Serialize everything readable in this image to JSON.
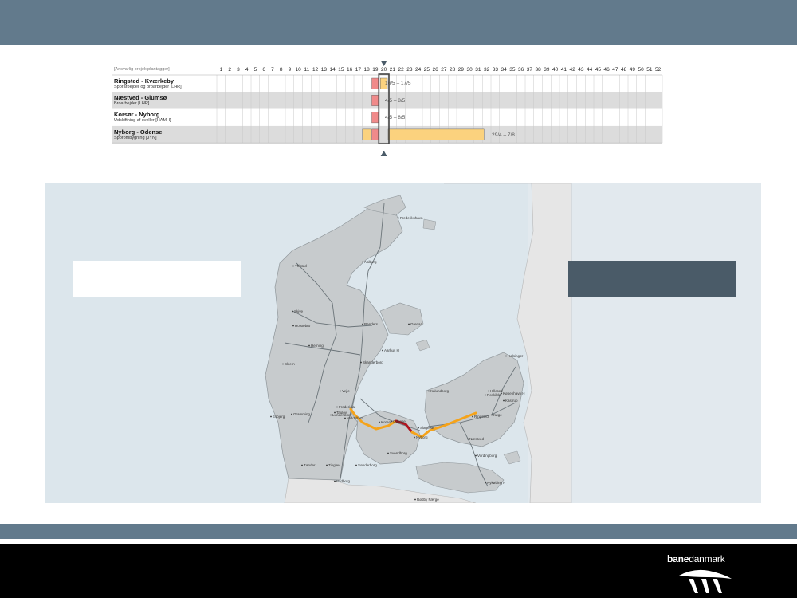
{
  "gantt": {
    "header_label": "[Ansvarlig projektplantagger]",
    "weeks": [
      "1",
      "2",
      "3",
      "4",
      "5",
      "6",
      "7",
      "8",
      "9",
      "10",
      "11",
      "12",
      "13",
      "14",
      "15",
      "16",
      "17",
      "18",
      "19",
      "20",
      "21",
      "22",
      "23",
      "24",
      "25",
      "26",
      "27",
      "28",
      "29",
      "30",
      "31",
      "32",
      "33",
      "34",
      "35",
      "36",
      "37",
      "38",
      "39",
      "40",
      "41",
      "42",
      "43",
      "44",
      "45",
      "46",
      "47",
      "48",
      "49",
      "50",
      "51",
      "52"
    ],
    "current_week": 20,
    "rows": [
      {
        "title": "Ringsted - Kværkeby",
        "subtitle": "Sporarbejder og broarbejder [LHR]",
        "range": "16/5 – 17/5"
      },
      {
        "title": "Næstved - Glumsø",
        "subtitle": "Broarbejder [LHR]",
        "range": "4/5 – 8/5"
      },
      {
        "title": "Korsør - Nyborg",
        "subtitle": "Udskiftning af sveller [HAMH]",
        "range": "4/5 – 8/5"
      },
      {
        "title": "Nyborg - Odense",
        "subtitle": "Sporombygning [JYN]",
        "range": "29/4 – 7/8"
      }
    ]
  },
  "map": {
    "cities": [
      "Frederikshavn",
      "Thisted",
      "Aalborg",
      "Skive",
      "Randers",
      "Grenaa",
      "Holstebro",
      "Herning",
      "Aarhus H",
      "Skjern",
      "Skanderborg",
      "Helsingør",
      "Hillerød",
      "Kalundborg",
      "Roskilde",
      "København H",
      "Køge",
      "Vejle",
      "Fredericia",
      "Taulov",
      "Esbjerg",
      "Gramming",
      "Lunderskov",
      "Odense",
      "Nyborg",
      "Korsør",
      "Slagelse",
      "Ringsted",
      "Næstved",
      "Vordingborg",
      "Tønder",
      "Tinglev",
      "Sønderborg",
      "Padborg",
      "Svendborg",
      "Nykøbing F",
      "Rødby Færge",
      "Kastrup",
      "Middelfart"
    ]
  },
  "colors": {
    "topbar": "#627a8c",
    "work_orange": "#f5a31a",
    "work_red": "#b0141e",
    "gantt_bar_red": "#f08a8a",
    "gantt_bar_yellow": "#fbd27e"
  },
  "brand": {
    "logo_part1": "bane",
    "logo_part2": "danmark"
  }
}
